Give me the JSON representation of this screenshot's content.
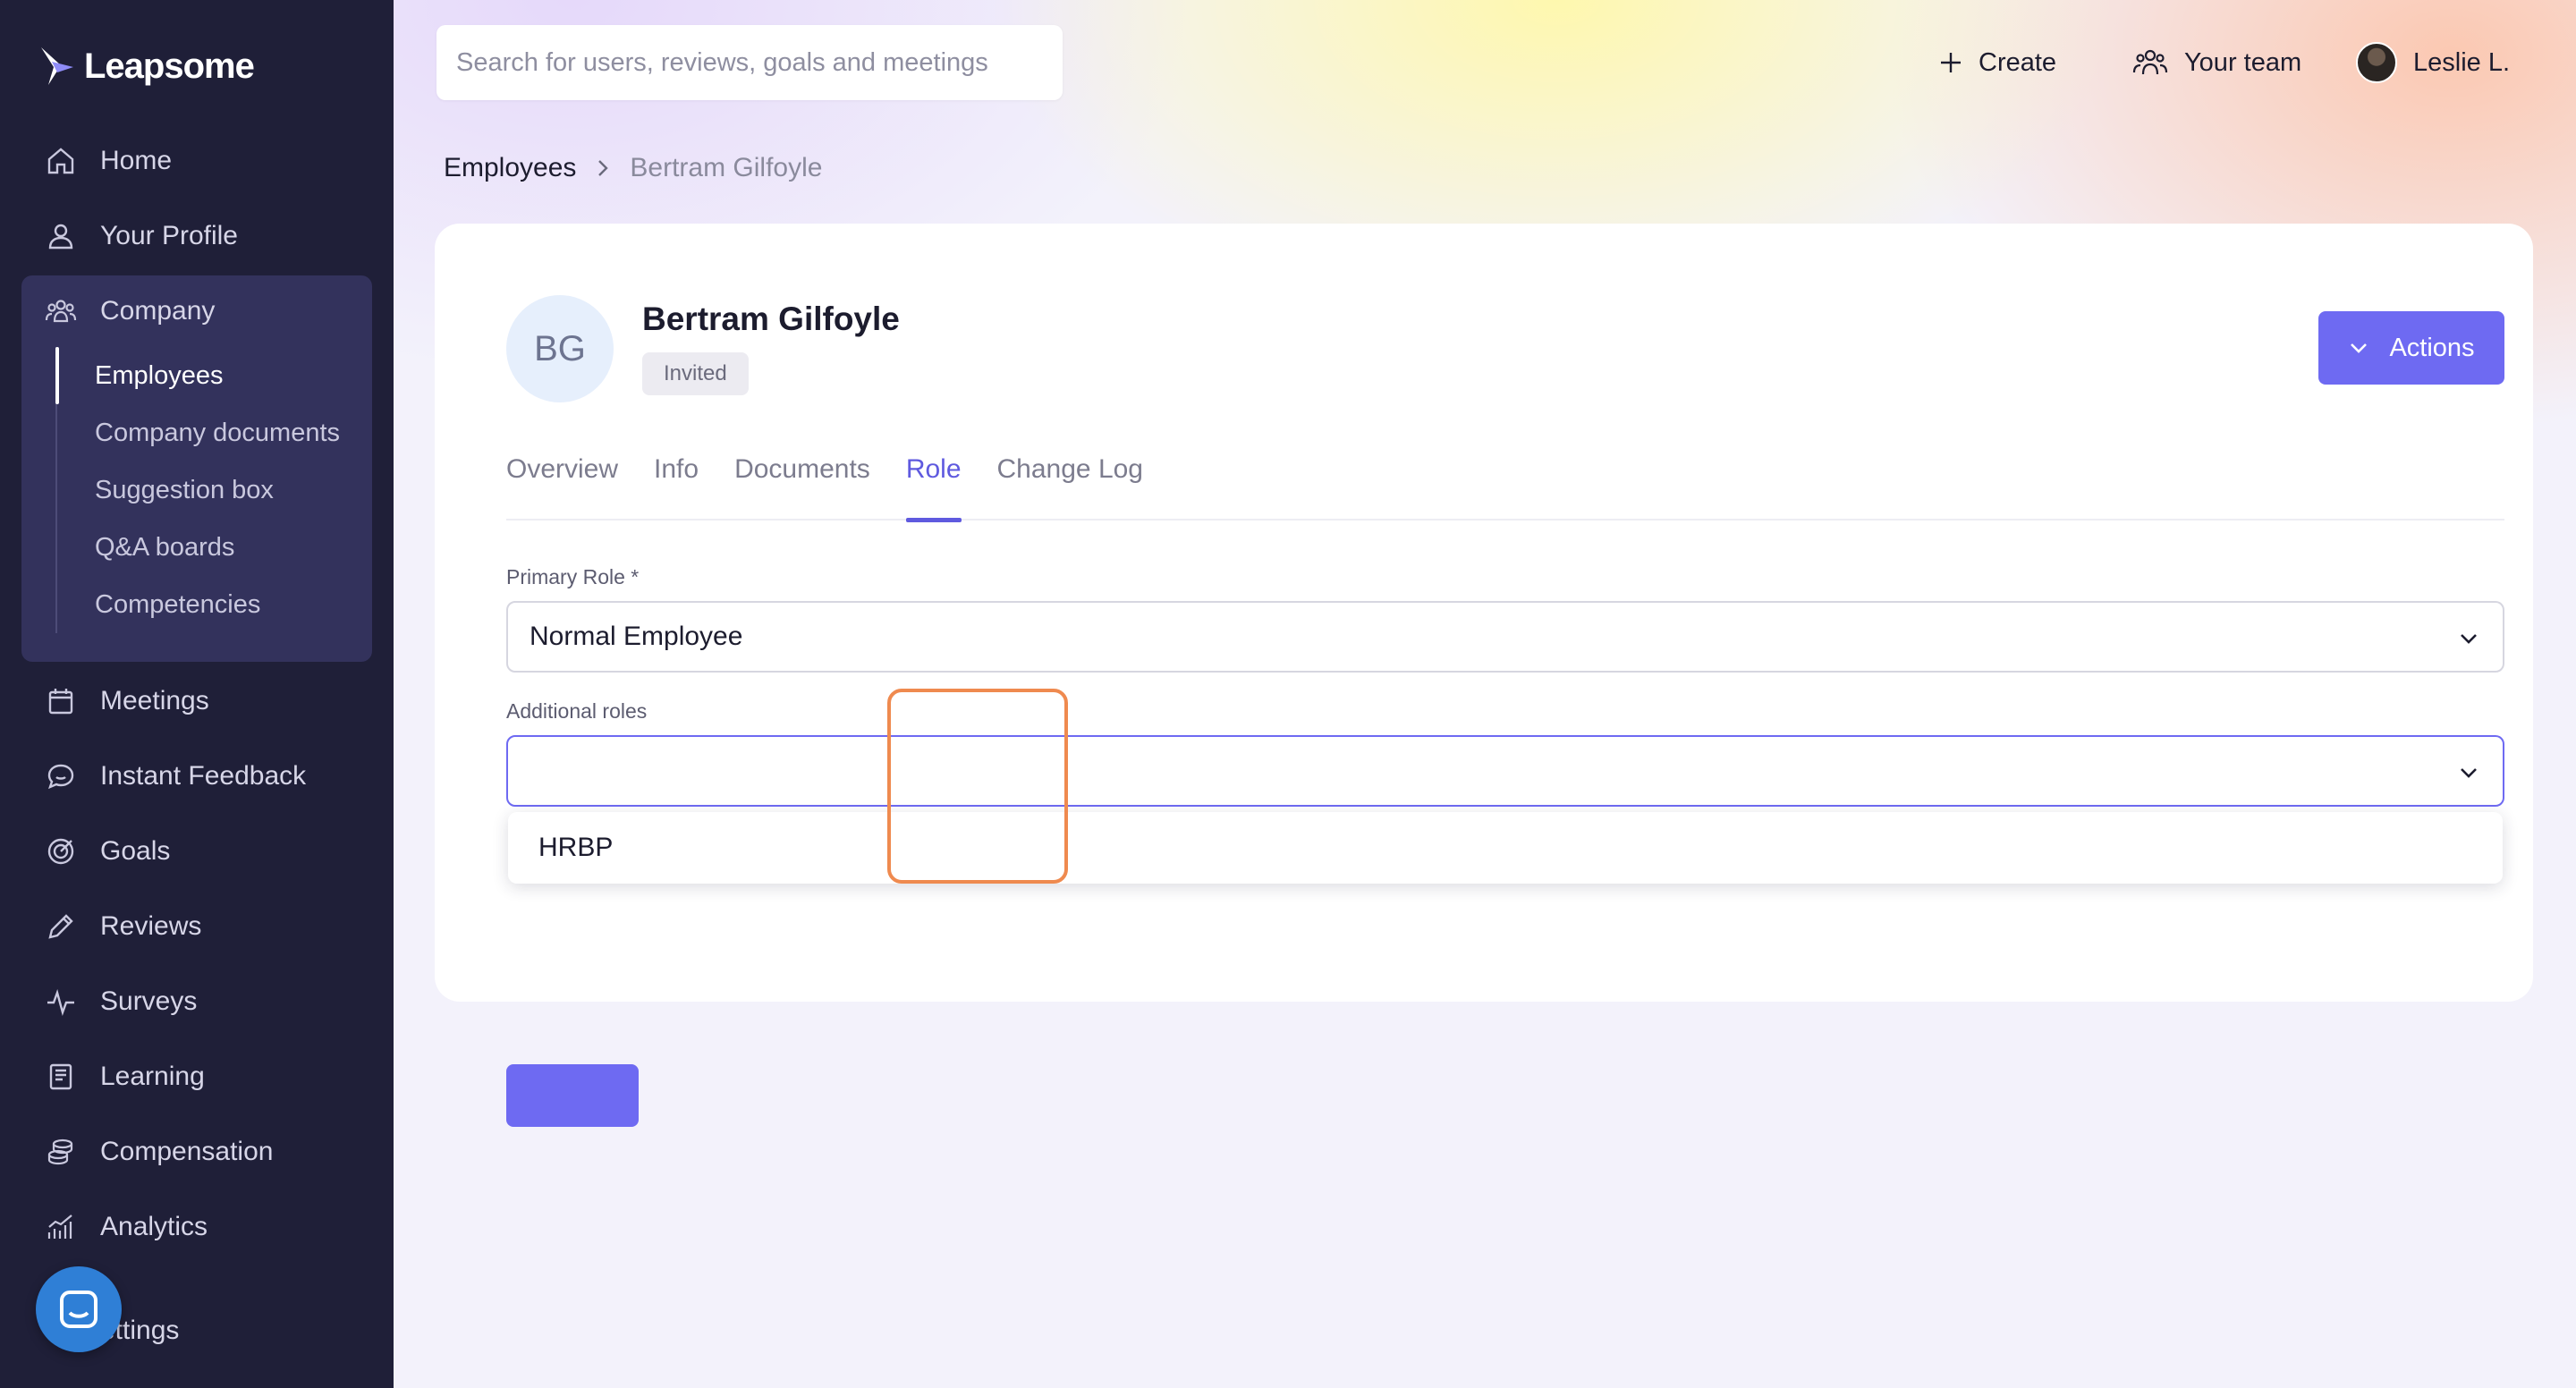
{
  "brand": {
    "name": "Leapsome"
  },
  "sidebar": {
    "items": [
      {
        "label": "Home",
        "icon": "home-icon"
      },
      {
        "label": "Your Profile",
        "icon": "user-icon"
      },
      {
        "label": "Company",
        "icon": "users-icon"
      },
      {
        "label": "Meetings",
        "icon": "calendar-icon"
      },
      {
        "label": "Instant Feedback",
        "icon": "chat-icon"
      },
      {
        "label": "Goals",
        "icon": "target-icon"
      },
      {
        "label": "Reviews",
        "icon": "pencil-icon"
      },
      {
        "label": "Surveys",
        "icon": "pulse-icon"
      },
      {
        "label": "Learning",
        "icon": "book-icon"
      },
      {
        "label": "Compensation",
        "icon": "coins-icon"
      },
      {
        "label": "Analytics",
        "icon": "chart-icon"
      },
      {
        "label": "ettings",
        "icon": "gear-icon"
      }
    ],
    "company_sub": [
      "Employees",
      "Company documents",
      "Suggestion box",
      "Q&A boards",
      "Competencies"
    ],
    "active_sub": "Employees"
  },
  "topbar": {
    "search_placeholder": "Search for users, reviews, goals and meetings",
    "create_label": "Create",
    "team_label": "Your team",
    "user_label": "Leslie L."
  },
  "breadcrumb": {
    "parent": "Employees",
    "current": "Bertram Gilfoyle"
  },
  "profile": {
    "initials": "BG",
    "name": "Bertram Gilfoyle",
    "status": "Invited",
    "actions_label": "Actions"
  },
  "tabs": [
    "Overview",
    "Info",
    "Documents",
    "Role",
    "Change Log"
  ],
  "active_tab": "Role",
  "form": {
    "primary_role_label": "Primary Role *",
    "primary_role_value": "Normal Employee",
    "additional_roles_label": "Additional roles",
    "additional_roles_value": "",
    "options": [
      "HRBP"
    ]
  },
  "colors": {
    "sidebar_bg": "#1f1f38",
    "accent": "#6e6af2",
    "highlight": "#ef8a4f"
  }
}
